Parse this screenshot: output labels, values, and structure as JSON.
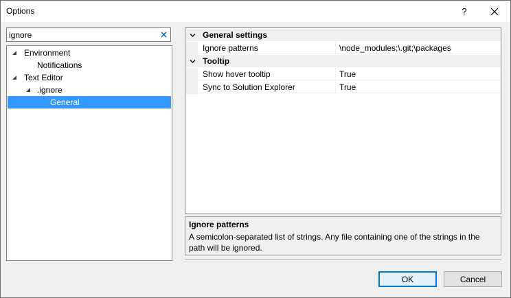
{
  "window": {
    "title": "Options",
    "help_glyph": "?"
  },
  "search": {
    "value": "ignore",
    "placeholder": ""
  },
  "tree": {
    "items": [
      {
        "label": "Environment",
        "level": 0,
        "expanded": true
      },
      {
        "label": "Notifications",
        "level": 1
      },
      {
        "label": "Text Editor",
        "level": 0,
        "expanded": true
      },
      {
        "label": ".ignore",
        "level": 1,
        "expanded": true
      },
      {
        "label": "General",
        "level": 2,
        "selected": true
      }
    ]
  },
  "grid": {
    "categories": [
      {
        "label": "General settings",
        "properties": [
          {
            "name": "Ignore patterns",
            "value": "\\node_modules;\\.git;\\packages"
          }
        ]
      },
      {
        "label": "Tooltip",
        "properties": [
          {
            "name": "Show hover tooltip",
            "value": "True"
          },
          {
            "name": "Sync to Solution Explorer",
            "value": "True"
          }
        ]
      }
    ]
  },
  "description": {
    "title": "Ignore patterns",
    "text": "A semicolon-separated list of strings. Any file containing one of the strings in the path will be ignored."
  },
  "buttons": {
    "ok": "OK",
    "cancel": "Cancel"
  },
  "colors": {
    "selection": "#3399ff",
    "default_button_border": "#0078d7"
  }
}
